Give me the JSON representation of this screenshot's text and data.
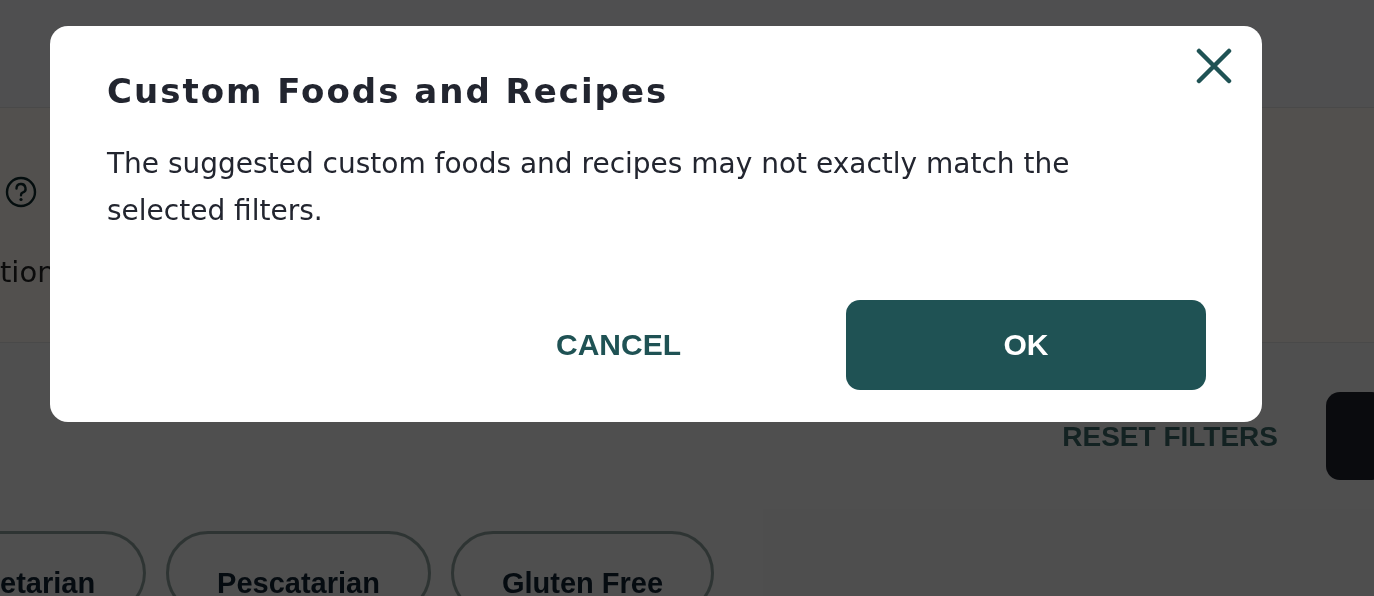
{
  "page": {
    "label_fragment": "tion",
    "reset_link": "RESET FILTERS",
    "filter_chips": [
      {
        "label": "etarian"
      },
      {
        "label": "Pescatarian"
      },
      {
        "label": "Gluten Free"
      }
    ]
  },
  "dialog": {
    "title": "Custom Foods and Recipes",
    "message": "The suggested custom foods and recipes may not exactly match the selected filters.",
    "buttons": [
      {
        "label": "CANCEL",
        "kind": "text"
      },
      {
        "label": "OK",
        "kind": "primary"
      }
    ]
  }
}
